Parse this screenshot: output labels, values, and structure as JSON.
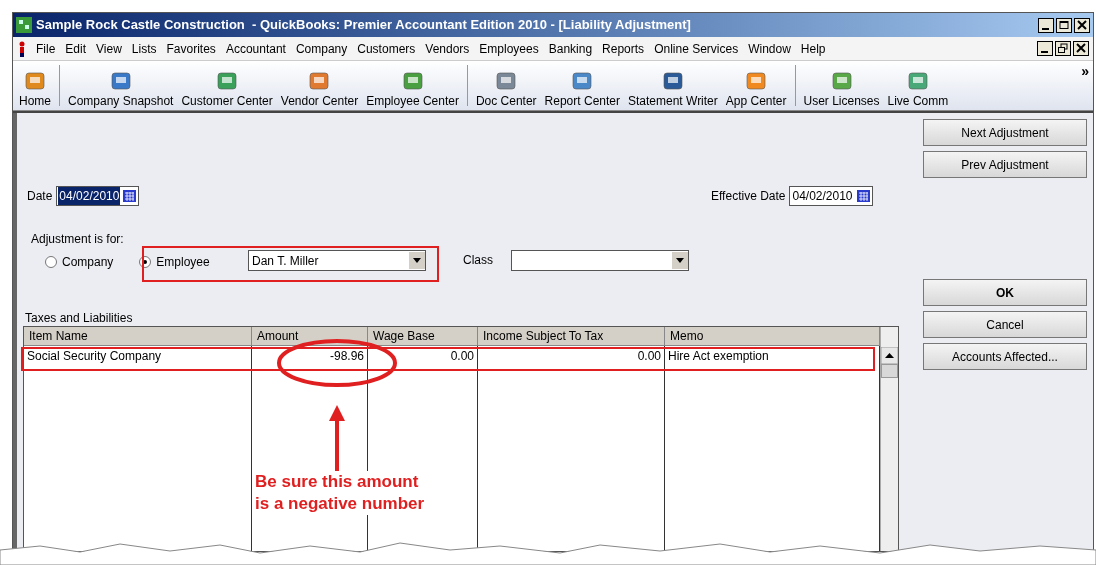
{
  "window": {
    "title": "Sample Rock Castle Construction  - QuickBooks: Premier Accountant Edition 2010 - [Liability Adjustment]"
  },
  "menu": [
    "File",
    "Edit",
    "View",
    "Lists",
    "Favorites",
    "Accountant",
    "Company",
    "Customers",
    "Vendors",
    "Employees",
    "Banking",
    "Reports",
    "Online Services",
    "Window",
    "Help"
  ],
  "toolbar": [
    [
      {
        "label": "Home",
        "color": "#e08a1e"
      }
    ],
    [
      {
        "label": "Company Snapshot",
        "color": "#3a78c8"
      },
      {
        "label": "Customer Center",
        "color": "#3aa05a"
      },
      {
        "label": "Vendor Center",
        "color": "#e07a30"
      },
      {
        "label": "Employee Center",
        "color": "#4aa040"
      }
    ],
    [
      {
        "label": "Doc Center",
        "color": "#7a8898"
      },
      {
        "label": "Report Center",
        "color": "#4a88c8"
      },
      {
        "label": "Statement Writer",
        "color": "#2a5a98"
      },
      {
        "label": "App Center",
        "color": "#f08a20"
      }
    ],
    [
      {
        "label": "User Licenses",
        "color": "#58a848"
      },
      {
        "label": "Live Comm",
        "color": "#48a878"
      }
    ]
  ],
  "toolbar_more": "»",
  "form": {
    "date_label": "Date",
    "date": "04/02/2010",
    "effective_label": "Effective Date",
    "effective_date": "04/02/2010",
    "adjustment_label": "Adjustment is for:",
    "options": [
      {
        "label": "Company",
        "selected": false
      },
      {
        "label": "Employee",
        "selected": true
      }
    ],
    "employee": "Dan T. Miller",
    "class_label": "Class"
  },
  "table": {
    "title": "Taxes and Liabilities",
    "columns": [
      "Item Name",
      "Amount",
      "Wage Base",
      "Income Subject To Tax",
      "Memo"
    ],
    "rows": [
      [
        "Social Security Company",
        "-98.96",
        "0.00",
        "0.00",
        "Hire Act exemption"
      ]
    ]
  },
  "buttons": [
    {
      "label": "Next Adjustment",
      "primary": false
    },
    {
      "label": "Prev Adjustment",
      "primary": false
    },
    {
      "label": "OK",
      "primary": true
    },
    {
      "label": "Cancel",
      "primary": false
    },
    {
      "label": "Accounts Affected...",
      "primary": false
    }
  ],
  "annotation": [
    "Be sure this amount",
    "is a negative number"
  ]
}
